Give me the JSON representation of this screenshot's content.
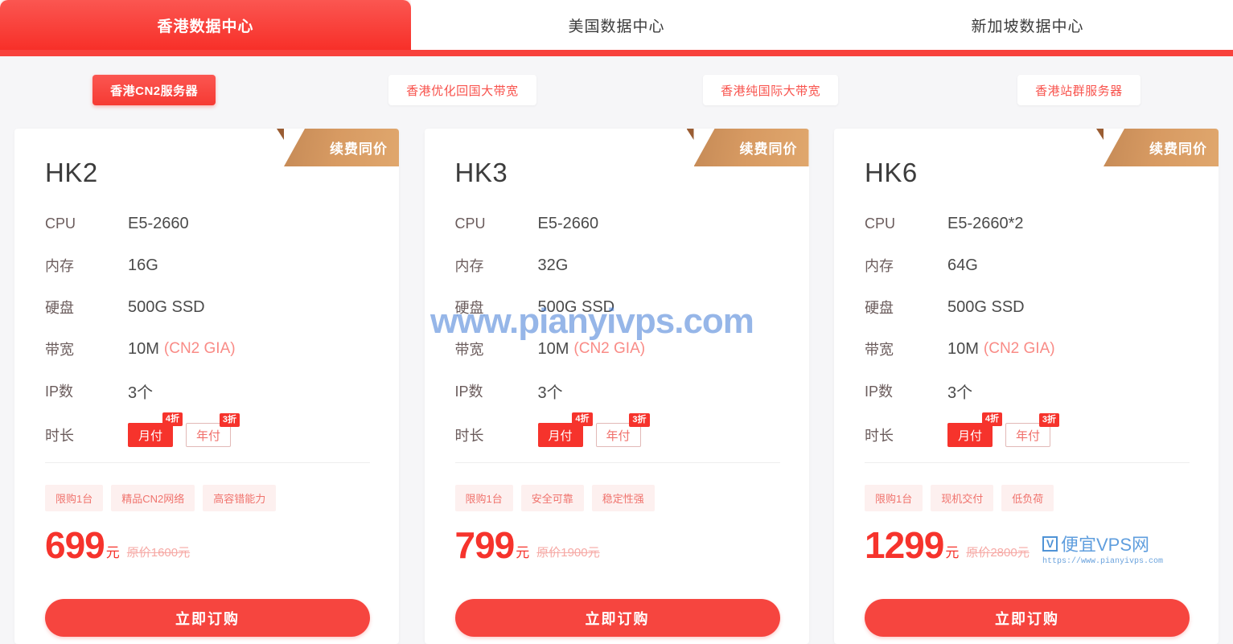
{
  "colors": {
    "brand_red": "#f6332c",
    "tab_red": "#f8423d",
    "ribbon_bronze": "#d79a62",
    "page_bg": "#f6f6f8",
    "watermark_blue": "#407ad6"
  },
  "tabs": [
    {
      "label": "香港数据中心",
      "active": true
    },
    {
      "label": "美国数据中心",
      "active": false
    },
    {
      "label": "新加坡数据中心",
      "active": false
    }
  ],
  "subtabs": [
    {
      "label": "香港CN2服务器",
      "active": true
    },
    {
      "label": "香港优化回国大带宽",
      "active": false
    },
    {
      "label": "香港纯国际大带宽",
      "active": false
    },
    {
      "label": "香港站群服务器",
      "active": false
    }
  ],
  "spec_keys": {
    "cpu": "CPU",
    "memory": "内存",
    "disk": "硬盘",
    "bandwidth": "带宽",
    "ip": "IP数",
    "duration": "时长"
  },
  "common": {
    "ribbon": "续费同价",
    "order_label": "立即订购",
    "monthly_label": "月付",
    "yearly_label": "年付",
    "monthly_discount": "4折",
    "yearly_discount": "3折",
    "currency_unit": "元"
  },
  "cards": [
    {
      "title": "HK2",
      "cpu": "E5-2660",
      "memory": "16G",
      "disk": "500G SSD",
      "bandwidth": "10M",
      "bandwidth_note": "(CN2 GIA)",
      "ip": "3个",
      "tags": [
        "限购1台",
        "精品CN2网络",
        "高容错能力"
      ],
      "price": "699",
      "original_price": "原价1600元"
    },
    {
      "title": "HK3",
      "cpu": "E5-2660",
      "memory": "32G",
      "disk": "500G SSD",
      "bandwidth": "10M",
      "bandwidth_note": "(CN2 GIA)",
      "ip": "3个",
      "tags": [
        "限购1台",
        "安全可靠",
        "稳定性强"
      ],
      "price": "799",
      "original_price": "原价1900元"
    },
    {
      "title": "HK6",
      "cpu": "E5-2660*2",
      "memory": "64G",
      "disk": "500G SSD",
      "bandwidth": "10M",
      "bandwidth_note": "(CN2 GIA)",
      "ip": "3个",
      "tags": [
        "限购1台",
        "现机交付",
        "低负荷"
      ],
      "price": "1299",
      "original_price": "原价2800元"
    }
  ],
  "watermarks": {
    "big": "www.pianyivps.com",
    "logo_mark": "V",
    "logo_name": "便宜VPS网",
    "logo_url": "https://www.pianyivps.com"
  }
}
